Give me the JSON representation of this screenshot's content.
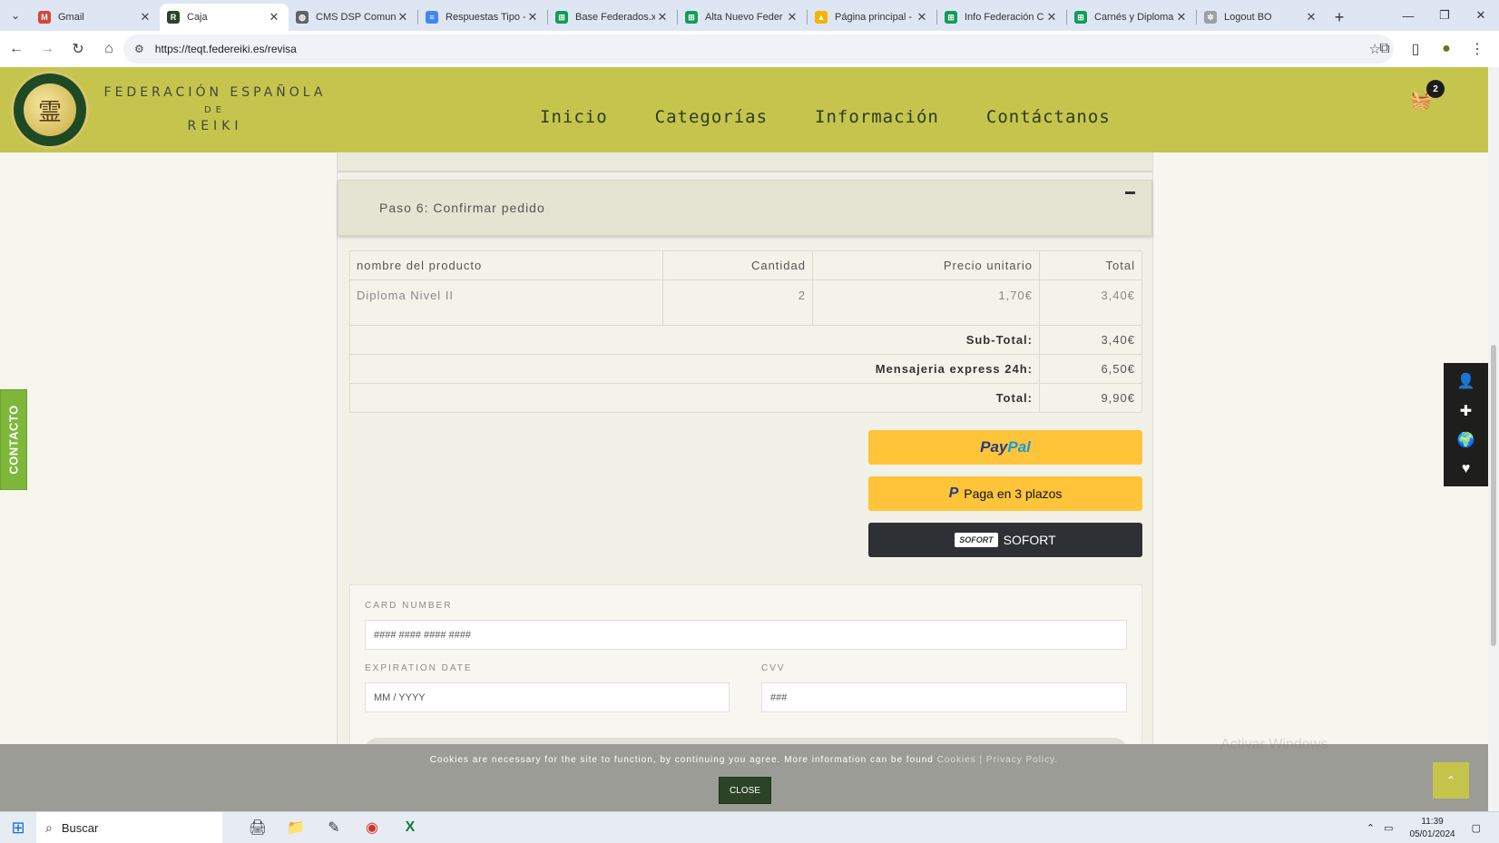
{
  "browser": {
    "tabs": [
      {
        "label": "Gmail",
        "favicon": "gmail-icon",
        "color": "#d44638",
        "glyph": "M"
      },
      {
        "label": "Caja",
        "favicon": "reiki-icon",
        "color": "#2c4327",
        "glyph": "R",
        "active": true
      },
      {
        "label": "CMS DSP Comuni",
        "favicon": "globe-icon",
        "color": "#5f6368",
        "glyph": "◍"
      },
      {
        "label": "Respuestas Tipo -",
        "favicon": "docs-icon",
        "color": "#4285f4",
        "glyph": "≡"
      },
      {
        "label": "Base Federados.xl",
        "favicon": "sheets-icon",
        "color": "#0f9d58",
        "glyph": "⊞"
      },
      {
        "label": "Alta Nuevo Feder",
        "favicon": "sheets-icon",
        "color": "#0f9d58",
        "glyph": "⊞"
      },
      {
        "label": "Página principal -",
        "favicon": "drive-icon",
        "color": "#f4b400",
        "glyph": "▲"
      },
      {
        "label": "Info Federación C",
        "favicon": "sheets-icon",
        "color": "#0f9d58",
        "glyph": "⊞"
      },
      {
        "label": "Carnés y Diploma",
        "favicon": "sheets-icon",
        "color": "#0f9d58",
        "glyph": "⊞"
      },
      {
        "label": "Logout BO",
        "favicon": "loading-icon",
        "color": "#9aa0a6",
        "glyph": "✲"
      }
    ],
    "url": "https://teqt.federeiki.es/revisa"
  },
  "site": {
    "brand_line1": "FEDERACIÓN ESPAÑOLA",
    "brand_line2": "DE",
    "brand_line3": "REIKI",
    "nav": [
      "Inicio",
      "Categorías",
      "Información",
      "Contáctanos"
    ],
    "cart_count": "2"
  },
  "checkout": {
    "step_title": "Paso 6: Confirmar pedido",
    "table": {
      "headers": [
        "nombre del producto",
        "Cantidad",
        "Precio unitario",
        "Total"
      ],
      "item": {
        "name": "Diploma Nivel II",
        "qty": "2",
        "unit_price": "1,70€",
        "total": "3,40€"
      },
      "subtotal_label": "Sub-Total:",
      "subtotal_value": "3,40€",
      "shipping_label": "Mensajeria express 24h:",
      "shipping_value": "6,50€",
      "total_label": "Total:",
      "total_value": "9,90€"
    },
    "paypal_part1": "Pay",
    "paypal_part2": "Pal",
    "paylater_label": "Paga en 3 plazos",
    "paylater_mark": "P",
    "sofort_chip": "SOFORT",
    "sofort_label": "SOFORT",
    "card": {
      "number_label": "CARD NUMBER",
      "number_placeholder": "#### #### #### ####",
      "expiration_label": "EXPIRATION DATE",
      "expiration_placeholder": "MM / YYYY",
      "cvv_label": "CVV",
      "cvv_placeholder": "###"
    }
  },
  "side": {
    "contacto": "CONTACTO"
  },
  "cookie": {
    "text": "Cookies are necessary for the site to function, by continuing you agree. More information can be found",
    "link_cookies": "Cookies",
    "separator": " | ",
    "link_privacy": "Privacy Policy.",
    "close": "CLOSE"
  },
  "watermark": "Activar Windows",
  "taskbar": {
    "search_placeholder": "Buscar",
    "time": "11:39",
    "date": "05/01/2024"
  },
  "colors": {
    "header": "#c5c54d",
    "paypal": "#ffc439",
    "sofort": "#2f3036",
    "contacto": "#7eb73a"
  }
}
